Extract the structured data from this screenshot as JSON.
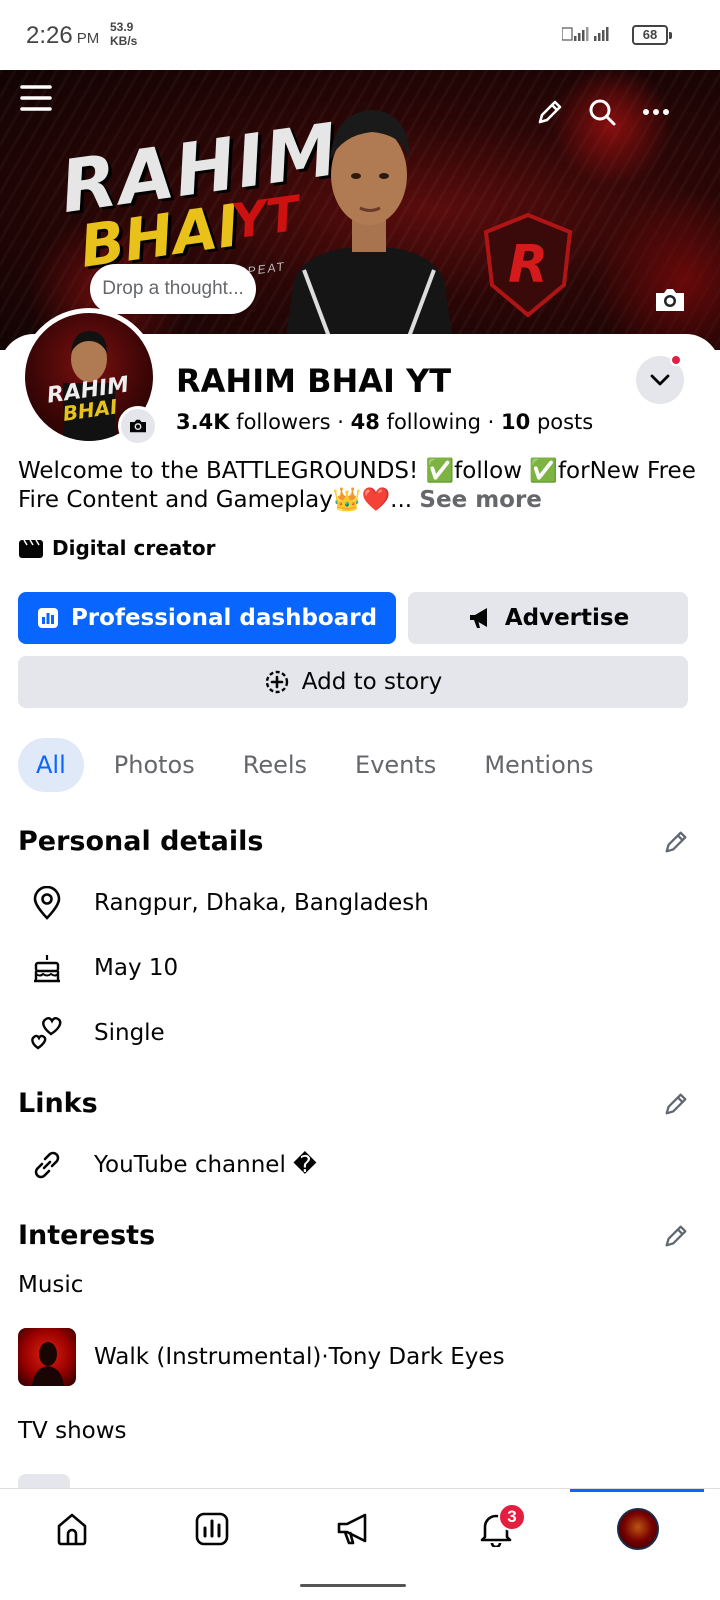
{
  "status_bar": {
    "time": "2:26",
    "ampm": "PM",
    "speed_value": "53.9",
    "speed_unit": "KB/s",
    "battery": "68"
  },
  "cover": {
    "title_line1": "RAHIM",
    "title_line2": "BHAI",
    "title_line3": "YT",
    "tagline": "ER · GAME · REPEAT",
    "thought_placeholder": "Drop a thought...",
    "emblem_letter": "R"
  },
  "avatar": {
    "line1": "RAHIM",
    "line2": "BHAI"
  },
  "profile": {
    "name": "RAHIM BHAI YT",
    "followers_count": "3.4K",
    "followers_label": "followers",
    "following_count": "48",
    "following_label": "following",
    "posts_count": "10",
    "posts_label": "posts",
    "separator": " · ",
    "bio": "Welcome to the BATTLEGROUNDS! ✅follow ✅forNew Free Fire Content and Gameplay👑❤️...",
    "see_more": "See more",
    "category": "Digital creator"
  },
  "actions": {
    "dashboard_label": "Professional dashboard",
    "advertise_label": "Advertise",
    "story_label": "Add to story"
  },
  "tabs": [
    {
      "label": "All",
      "active": true
    },
    {
      "label": "Photos",
      "active": false
    },
    {
      "label": "Reels",
      "active": false
    },
    {
      "label": "Events",
      "active": false
    },
    {
      "label": "Mentions",
      "active": false
    }
  ],
  "personal_details": {
    "title": "Personal details",
    "location": "Rangpur, Dhaka, Bangladesh",
    "birthday": "May 10",
    "relationship": "Single"
  },
  "links": {
    "title": "Links",
    "youtube": "YouTube channel �"
  },
  "interests": {
    "title": "Interests",
    "music_label": "Music",
    "music_item": "Walk (Instrumental)·Tony Dark Eyes",
    "tv_label": "TV shows"
  },
  "bottom_nav": {
    "notification_badge": "3",
    "active_tab": "profile"
  },
  "colors": {
    "accent": "#0866ff",
    "badge": "#e41e3f",
    "secondary_button": "#e4e6eb",
    "muted_text": "#65676b"
  }
}
